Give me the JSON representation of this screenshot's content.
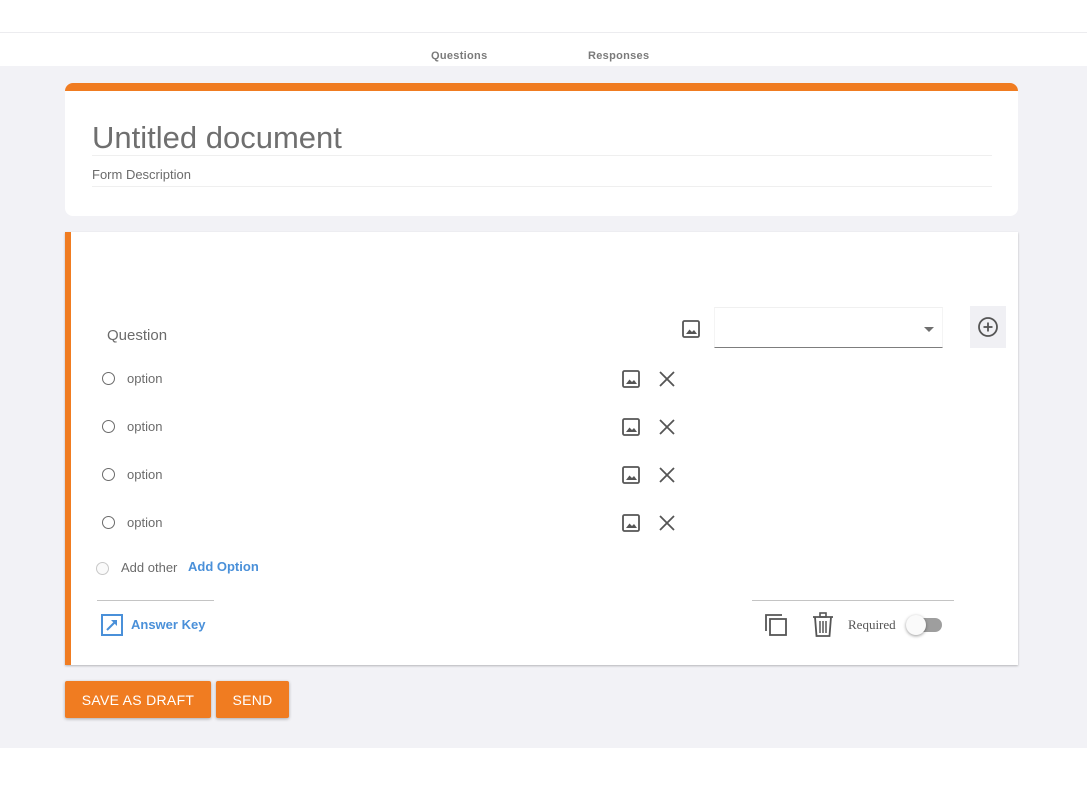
{
  "nav": {
    "tabs": [
      {
        "label": "Questions"
      },
      {
        "label": "Responses"
      }
    ]
  },
  "form": {
    "title": "Untitled document",
    "description": "Form Description",
    "accent_color": "#f07c21"
  },
  "question": {
    "label": "Question",
    "type_select_value": "",
    "options": [
      {
        "label": "option"
      },
      {
        "label": "option"
      },
      {
        "label": "option"
      },
      {
        "label": "option"
      }
    ],
    "add_other_label": "Add other",
    "add_option_label": "Add Option",
    "answer_key_label": "Answer Key",
    "required_label": "Required",
    "required_on": false
  },
  "actions": {
    "save_draft_label": "SAVE AS DRAFT",
    "send_label": "SEND"
  },
  "icons": {
    "image": "image-icon",
    "close": "close-icon",
    "add_circle": "add-circle-icon",
    "copy": "copy-icon",
    "trash": "trash-icon",
    "answer_key": "answer-key-icon"
  }
}
